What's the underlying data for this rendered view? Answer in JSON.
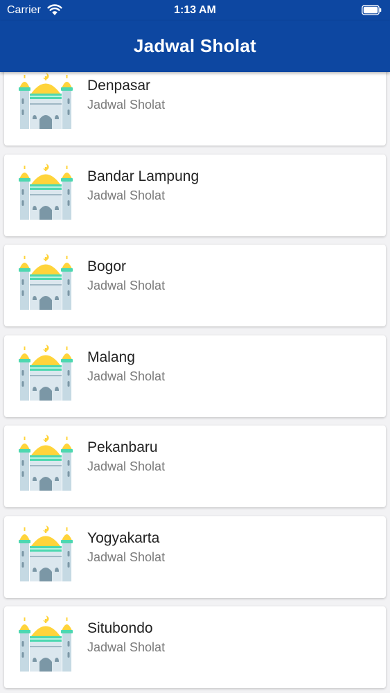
{
  "status_bar": {
    "carrier": "Carrier",
    "time": "1:13 AM",
    "wifi_icon": "wifi-icon",
    "battery_icon": "battery-icon"
  },
  "app_bar": {
    "title": "Jadwal Sholat",
    "background_color": "#0d47a1"
  },
  "cities": [
    {
      "name": "Denpasar",
      "subtitle": "Jadwal Sholat",
      "icon": "mosque-icon"
    },
    {
      "name": "Bandar Lampung",
      "subtitle": "Jadwal Sholat",
      "icon": "mosque-icon"
    },
    {
      "name": "Bogor",
      "subtitle": "Jadwal Sholat",
      "icon": "mosque-icon"
    },
    {
      "name": "Malang",
      "subtitle": "Jadwal Sholat",
      "icon": "mosque-icon"
    },
    {
      "name": "Pekanbaru",
      "subtitle": "Jadwal Sholat",
      "icon": "mosque-icon"
    },
    {
      "name": "Yogyakarta",
      "subtitle": "Jadwal Sholat",
      "icon": "mosque-icon"
    },
    {
      "name": "Situbondo",
      "subtitle": "Jadwal Sholat",
      "icon": "mosque-icon"
    }
  ]
}
